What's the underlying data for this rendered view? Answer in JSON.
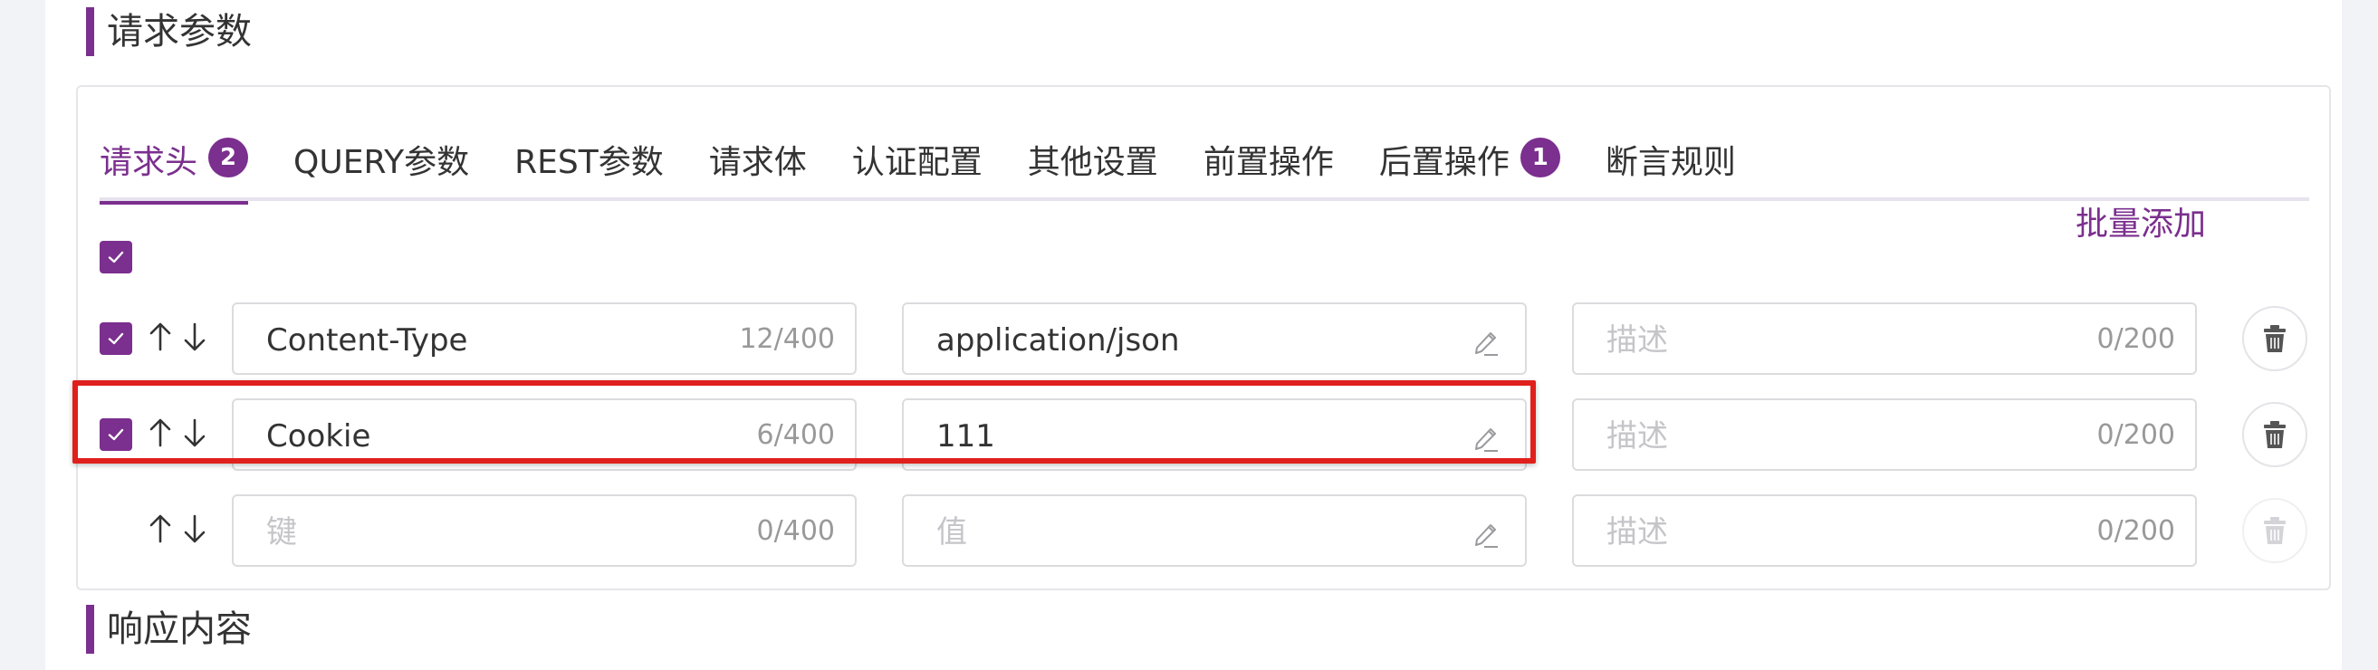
{
  "sections": {
    "request_params": "请求参数",
    "response_content": "响应内容"
  },
  "tabs": [
    {
      "label": "请求头",
      "badge": "2",
      "active": true
    },
    {
      "label": "QUERY参数"
    },
    {
      "label": "REST参数"
    },
    {
      "label": "请求体"
    },
    {
      "label": "认证配置"
    },
    {
      "label": "其他设置"
    },
    {
      "label": "前置操作"
    },
    {
      "label": "后置操作",
      "badge": "1"
    },
    {
      "label": "断言规则"
    }
  ],
  "batch_add_label": "批量添加",
  "rows": [
    {
      "checked": true,
      "key": "Content-Type",
      "key_count": "12/400",
      "value": "application/json",
      "desc_placeholder": "描述",
      "desc_count": "0/200"
    },
    {
      "checked": true,
      "key": "Cookie",
      "key_count": "6/400",
      "value": "111",
      "desc_placeholder": "描述",
      "desc_count": "0/200"
    },
    {
      "checked": false,
      "key_placeholder": "键",
      "key_count": "0/400",
      "value_placeholder": "值",
      "desc_placeholder": "描述",
      "desc_count": "0/200"
    }
  ],
  "colors": {
    "accent": "#7b2f8e",
    "highlight": "#e0201c"
  },
  "icons": {
    "checkbox": "check-icon",
    "sort_up": "arrow-up-icon",
    "sort_down": "arrow-down-icon",
    "edit": "pencil-icon",
    "delete": "trash-icon"
  }
}
